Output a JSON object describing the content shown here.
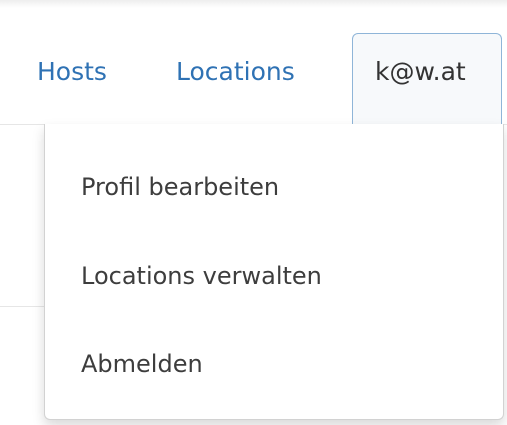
{
  "nav": {
    "links": [
      {
        "label": "Hosts"
      },
      {
        "label": "Locations"
      }
    ],
    "user": {
      "label": "k@w.at"
    }
  },
  "dropdown": {
    "items": [
      {
        "label": "Profil bearbeiten"
      },
      {
        "label": "Locations verwalten"
      },
      {
        "label": "Abmelden"
      }
    ]
  },
  "colors": {
    "link": "#2f72b4",
    "text": "#3d3d3d",
    "tab_border": "#8fb5d8"
  }
}
